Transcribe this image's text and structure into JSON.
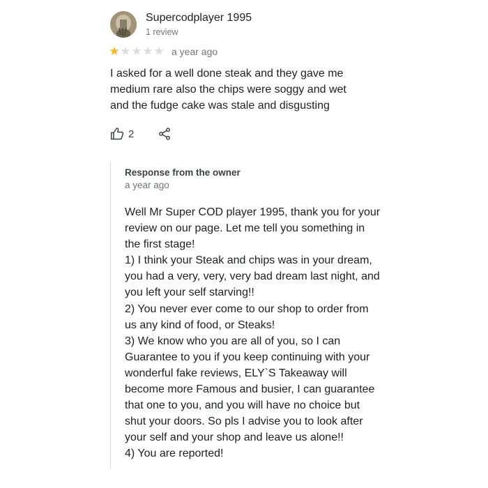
{
  "review": {
    "author_name": "Supercodplayer 1995",
    "review_count": "1 review",
    "rating": 1,
    "max_rating": 5,
    "time": "a year ago",
    "text_lines": [
      "I asked for a well done steak and they gave me",
      "medium rare also the chips were soggy and wet",
      "and the fudge cake was stale and disgusting"
    ],
    "like_count": "2",
    "icons": {
      "more": "more-vert-icon",
      "like": "thumbs-up-icon",
      "share": "share-icon"
    },
    "colors": {
      "star_filled": "#f9b81e",
      "star_empty": "#dadce0",
      "secondary_text": "#70757a"
    }
  },
  "owner_response": {
    "title": "Response from the owner",
    "time": "a year ago",
    "text_lines": [
      "Well Mr Super COD player 1995, thank you for your",
      "review on our page. Let me tell you something in",
      "the first stage!",
      "1) I think your Steak and chips was in your dream,",
      "you had a very, very, very bad dream last night, and",
      "you left your self starving!!",
      "2) You never ever come to our shop to order from",
      "us any kind of food, or Steaks!",
      "3) We know who you are all of you, so I can",
      "Guarantee to you if you keep continuing with your",
      "wonderful fake reviews, ELY`S Takeaway will",
      "become more Famous and busier, I can guarantee",
      "that one to you, and you will have no choice but",
      "shut your doors. So pls I advise you to look after",
      "your self and your shop and leave us alone!!",
      "4) You are reported!"
    ]
  }
}
